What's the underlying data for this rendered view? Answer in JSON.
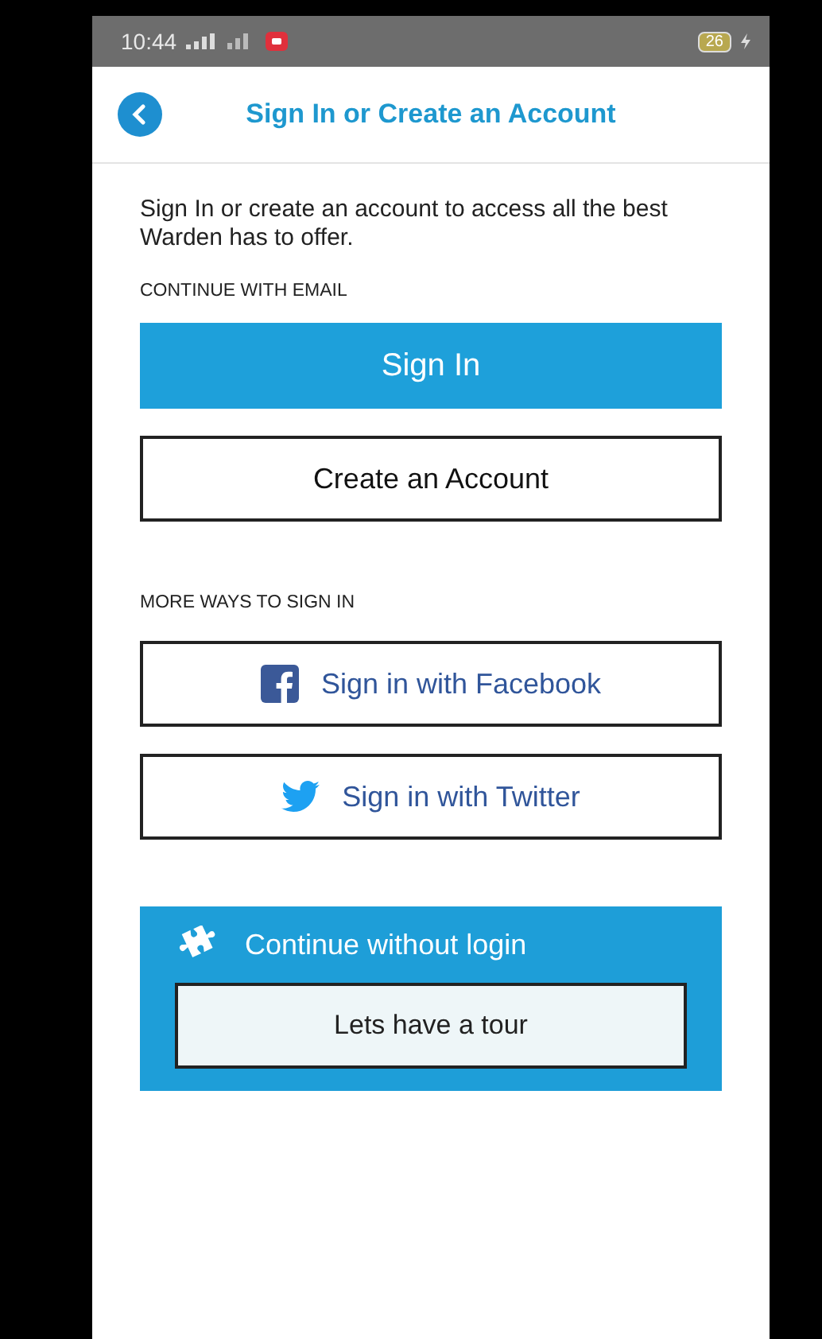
{
  "status_bar": {
    "time": "10:44",
    "battery": "26"
  },
  "header": {
    "title": "Sign In or Create an Account"
  },
  "intro": "Sign In or create an account to access all the best Warden has to offer.",
  "email_section": {
    "label": "CONTINUE WITH EMAIL",
    "buttons": [
      {
        "label": "Sign  In",
        "kind": "primary"
      },
      {
        "label": "Create an Account",
        "kind": "outline"
      }
    ]
  },
  "social_section": {
    "label": "MORE WAYS TO SIGN IN",
    "buttons": [
      {
        "label": "Sign in with Facebook",
        "kind": "facebook"
      },
      {
        "label": "Sign in with Twitter",
        "kind": "twitter"
      }
    ]
  },
  "guest_panel": {
    "title": "Continue without login",
    "button": "Lets have a tour"
  }
}
